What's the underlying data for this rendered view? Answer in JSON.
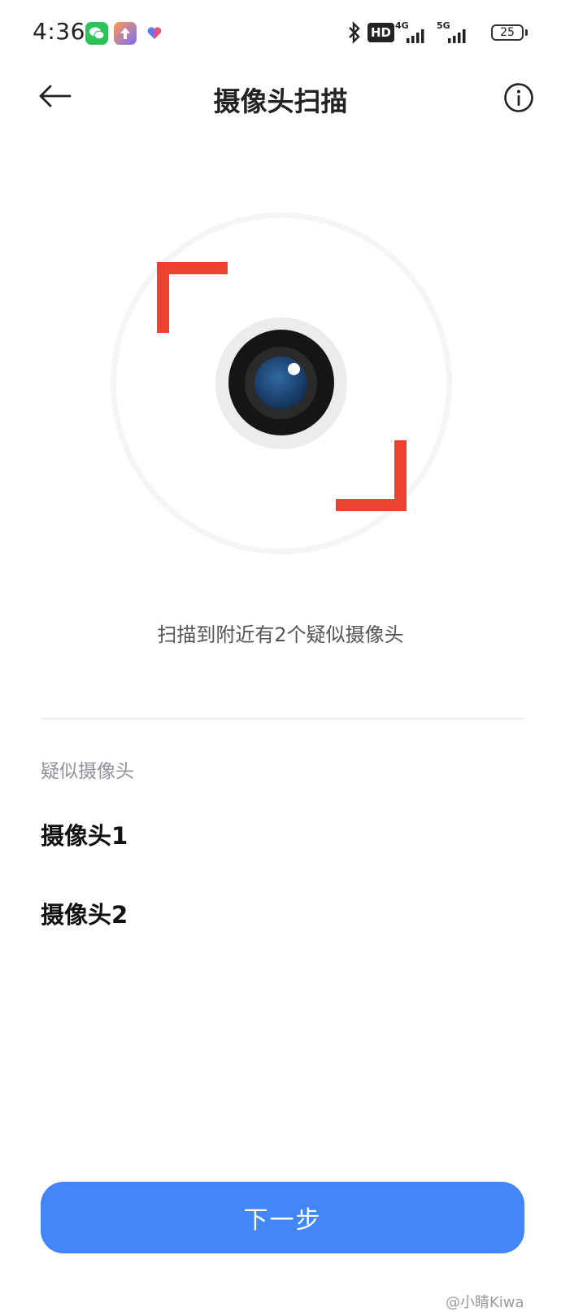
{
  "status_bar": {
    "time": "4:36",
    "hd_label": "HD",
    "net1_label": "4G",
    "net2_label": "5G",
    "battery": "25",
    "icons": [
      "wechat-icon",
      "upload-icon",
      "health-icon",
      "bluetooth-icon",
      "signal-icon",
      "battery-icon"
    ]
  },
  "header": {
    "title": "摄像头扫描",
    "back_icon": "arrow-left-icon",
    "info_icon": "info-icon"
  },
  "scan": {
    "result_text": "扫描到附近有2个疑似摄像头",
    "frame_color": "#ec4230"
  },
  "list": {
    "section_label": "疑似摄像头",
    "items": [
      {
        "label": "摄像头1"
      },
      {
        "label": "摄像头2"
      }
    ]
  },
  "footer": {
    "next_label": "下一步",
    "button_color": "#4286f7"
  },
  "watermark": "@小睛Kiwa"
}
